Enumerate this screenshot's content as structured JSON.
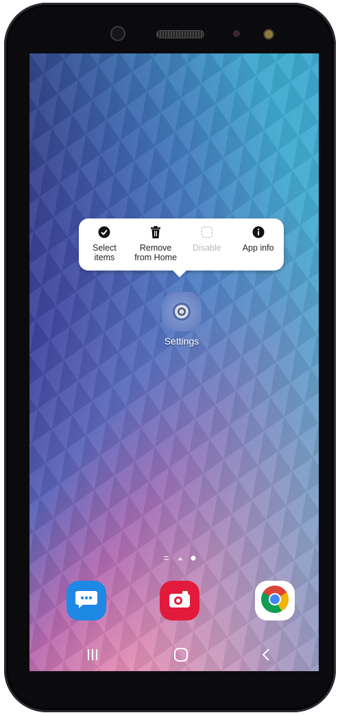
{
  "popup": {
    "actions": [
      {
        "label": "Select\nitems",
        "icon": "check-circle-icon"
      },
      {
        "label": "Remove\nfrom Home",
        "icon": "trash-icon"
      },
      {
        "label": "Disable",
        "icon": "dashed-square-icon",
        "disabled": true
      },
      {
        "label": "App info",
        "icon": "info-icon"
      }
    ]
  },
  "app": {
    "label": "Settings",
    "icon": "settings-gear-icon"
  },
  "dock": [
    {
      "icon": "messages-icon",
      "color": "#1e88e5"
    },
    {
      "icon": "camera-icon",
      "color": "#e21b3c"
    },
    {
      "icon": "chrome-icon",
      "color": "#ffffff"
    }
  ],
  "navigation": [
    "recents-icon",
    "home-icon",
    "back-icon"
  ],
  "pager": [
    "menu-indicator",
    "home-dot",
    "page-dot-active"
  ]
}
